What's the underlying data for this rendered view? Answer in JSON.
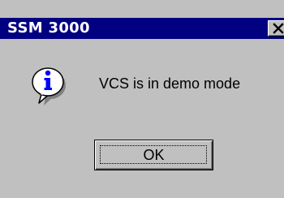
{
  "window": {
    "title": "SSM 3000",
    "close_icon": "close-icon"
  },
  "message": {
    "icon": "information-icon",
    "text": "VCS is in demo mode"
  },
  "buttons": {
    "ok_label": "OK"
  },
  "colors": {
    "titlebar": "#000080",
    "title_text": "#ffffff",
    "dialog_background": "#c0c0c0",
    "info_icon_fill": "#0000ff"
  }
}
